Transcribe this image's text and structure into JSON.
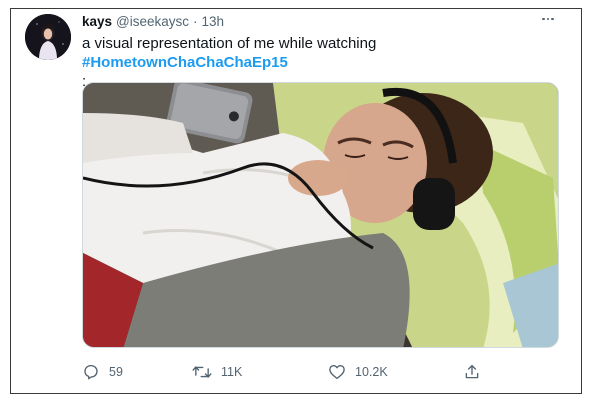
{
  "tweet": {
    "display_name": "kays",
    "handle": "@iseekaysc",
    "separator": "·",
    "time": "13h",
    "text_prefix": "a visual representation of me while watching ",
    "hashtag": "#HometownChaChaChaEp15",
    "text_suffix": ":"
  },
  "actions": {
    "replies": "59",
    "retweets": "11K",
    "likes": "10.2K"
  },
  "icons": {
    "reply": "reply-icon",
    "retweet": "retweet-icon",
    "like": "heart-icon",
    "share": "share-icon",
    "more": "more-horizontal-icon"
  },
  "colors": {
    "hashtag": "#1d9bf0",
    "text": "#0f1419",
    "secondary": "#536471"
  }
}
